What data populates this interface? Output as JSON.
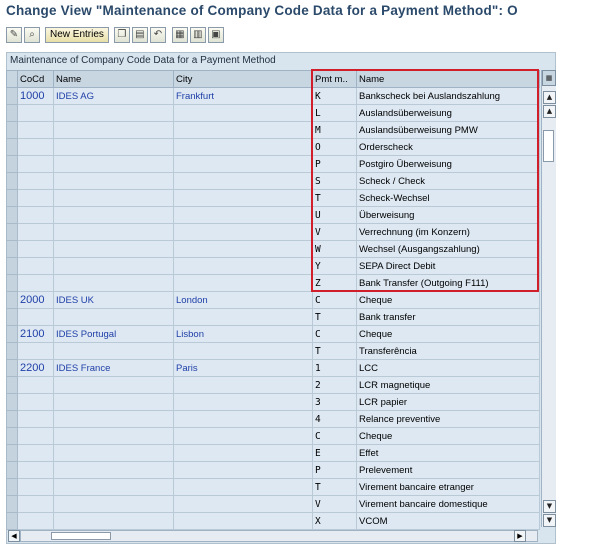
{
  "window": {
    "title": "Change View \"Maintenance of Company Code Data for a Payment Method\": O"
  },
  "toolbar": {
    "new_entries_label": "New Entries"
  },
  "table": {
    "caption": "Maintenance of Company Code Data for a Payment Method",
    "columns": [
      "CoCd",
      "Name",
      "City",
      "Pmt m..",
      "Name"
    ],
    "rows": [
      [
        "1000",
        "IDES AG",
        "Frankfurt",
        "K",
        "Bankscheck bei Auslandszahlung"
      ],
      [
        "",
        "",
        "",
        "L",
        "Auslandsüberweisung"
      ],
      [
        "",
        "",
        "",
        "M",
        "Auslandsüberweisung PMW"
      ],
      [
        "",
        "",
        "",
        "O",
        "Orderscheck"
      ],
      [
        "",
        "",
        "",
        "P",
        "Postgiro Überweisung"
      ],
      [
        "",
        "",
        "",
        "S",
        "Scheck / Check"
      ],
      [
        "",
        "",
        "",
        "T",
        "Scheck-Wechsel"
      ],
      [
        "",
        "",
        "",
        "U",
        "Überweisung"
      ],
      [
        "",
        "",
        "",
        "V",
        "Verrechnung (im Konzern)"
      ],
      [
        "",
        "",
        "",
        "W",
        "Wechsel (Ausgangszahlung)"
      ],
      [
        "",
        "",
        "",
        "Y",
        "SEPA Direct Debit"
      ],
      [
        "",
        "",
        "",
        "Z",
        "Bank Transfer (Outgoing F111)"
      ],
      [
        "2000",
        "IDES UK",
        "London",
        "C",
        "Cheque"
      ],
      [
        "",
        "",
        "",
        "T",
        "Bank transfer"
      ],
      [
        "2100",
        "IDES Portugal",
        "Lisbon",
        "C",
        "Cheque"
      ],
      [
        "",
        "",
        "",
        "T",
        "Transferência"
      ],
      [
        "2200",
        "IDES France",
        "Paris",
        "1",
        "LCC"
      ],
      [
        "",
        "",
        "",
        "2",
        "LCR magnetique"
      ],
      [
        "",
        "",
        "",
        "3",
        "LCR papier"
      ],
      [
        "",
        "",
        "",
        "4",
        "Relance preventive"
      ],
      [
        "",
        "",
        "",
        "C",
        "Cheque"
      ],
      [
        "",
        "",
        "",
        "E",
        "Effet"
      ],
      [
        "",
        "",
        "",
        "P",
        "Prelevement"
      ],
      [
        "",
        "",
        "",
        "T",
        "Virement bancaire etranger"
      ],
      [
        "",
        "",
        "",
        "V",
        "Virement bancaire domestique"
      ],
      [
        "",
        "",
        "",
        "X",
        "VCOM"
      ]
    ]
  },
  "colors": {
    "highlight": "#d01e2a",
    "link_text": "#1f3fa8",
    "grid_background": "#dde8f2"
  },
  "icons": [
    "check-icon",
    "find-icon",
    "new-entries-button",
    "copy-icon",
    "delete-icon",
    "undo-icon",
    "select-all-icon",
    "select-block-icon",
    "deselect-all-icon"
  ]
}
